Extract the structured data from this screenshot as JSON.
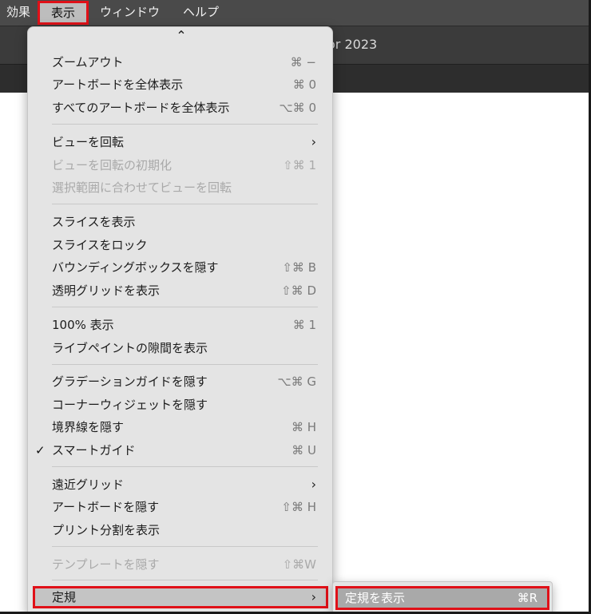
{
  "menubar": {
    "items": [
      "効果",
      "表示",
      "ウィンドウ",
      "ヘルプ"
    ]
  },
  "window": {
    "title": "or 2023"
  },
  "menu": {
    "scroll_up": "⌃",
    "items": [
      {
        "label": "ズームアウト",
        "shortcut": "⌘ −"
      },
      {
        "label": "アートボードを全体表示",
        "shortcut": "⌘ 0"
      },
      {
        "label": "すべてのアートボードを全体表示",
        "shortcut": "⌥⌘ 0"
      },
      {
        "label": "ビューを回転",
        "shortcut": "›"
      },
      {
        "label": "ビューを回転の初期化",
        "shortcut": "⇧⌘ 1"
      },
      {
        "label": "選択範囲に合わせてビューを回転",
        "shortcut": ""
      },
      {
        "label": "スライスを表示",
        "shortcut": ""
      },
      {
        "label": "スライスをロック",
        "shortcut": ""
      },
      {
        "label": "バウンディングボックスを隠す",
        "shortcut": "⇧⌘ B"
      },
      {
        "label": "透明グリッドを表示",
        "shortcut": "⇧⌘ D"
      },
      {
        "label": "100% 表示",
        "shortcut": "⌘ 1"
      },
      {
        "label": "ライブペイントの隙間を表示",
        "shortcut": ""
      },
      {
        "label": "グラデーションガイドを隠す",
        "shortcut": "⌥⌘ G"
      },
      {
        "label": "コーナーウィジェットを隠す",
        "shortcut": ""
      },
      {
        "label": "境界線を隠す",
        "shortcut": "⌘ H"
      },
      {
        "label": "スマートガイド",
        "shortcut": "⌘ U",
        "check": "✓"
      },
      {
        "label": "遠近グリッド",
        "shortcut": "›"
      },
      {
        "label": "アートボードを隠す",
        "shortcut": "⇧⌘ H"
      },
      {
        "label": "プリント分割を表示",
        "shortcut": ""
      },
      {
        "label": "テンプレートを隠す",
        "shortcut": "⇧⌘W"
      },
      {
        "label": "定規",
        "shortcut": "›"
      }
    ]
  },
  "submenu": {
    "items": [
      {
        "label": "定規を表示",
        "shortcut": "⌘R"
      }
    ]
  },
  "colors": {
    "highlight_border": "#e01018",
    "menu_bg": "#e4e4e4",
    "menubar_bg": "#4a4a4a"
  }
}
